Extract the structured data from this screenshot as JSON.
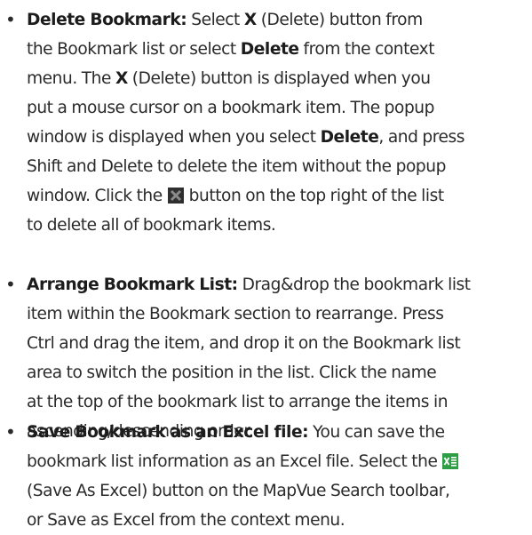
{
  "items": [
    {
      "lines": [
        [
          {
            "t": "Delete Bookmark:",
            "b": true
          },
          {
            "t": " Select "
          },
          {
            "t": "X",
            "b": true
          },
          {
            "t": " (Delete) button from"
          }
        ],
        [
          {
            "t": "the Bookmark list or select "
          },
          {
            "t": "Delete",
            "b": true
          },
          {
            "t": " from the context"
          }
        ],
        [
          {
            "t": "menu. The "
          },
          {
            "t": "X",
            "b": true
          },
          {
            "t": " (Delete) button is displayed when you"
          }
        ],
        [
          {
            "t": "put a mouse cursor on a bookmark item. The popup"
          }
        ],
        [
          {
            "t": "window is displayed when you select "
          },
          {
            "t": "Delete",
            "b": true
          },
          {
            "t": ", and press"
          }
        ],
        [
          {
            "t": "Shift and Delete to delete the item without the popup"
          }
        ],
        [
          {
            "t": "window. Click the "
          },
          {
            "icon": "delete-all-icon"
          },
          {
            "t": " button on the top right of the list"
          }
        ],
        [
          {
            "t": "to delete all of bookmark items."
          }
        ]
      ]
    },
    {
      "lines": [
        [
          {
            "t": "Arrange Bookmark List:",
            "b": true
          },
          {
            "t": " Drag&drop the bookmark list"
          }
        ],
        [
          {
            "t": "item within the Bookmark section to rearrange. Press"
          }
        ],
        [
          {
            "t": "Ctrl and drag the item, and drop it on the Bookmark list"
          }
        ],
        [
          {
            "t": "area to switch the position in the list. Click the name"
          }
        ],
        [
          {
            "t": "at the top of the bookmark list to arrange the items in"
          }
        ],
        [
          {
            "t": "ascending/descending order."
          }
        ]
      ]
    },
    {
      "lines": [
        [
          {
            "t": "Save Bookmark as an Excel file:",
            "b": true
          },
          {
            "t": " You can save the"
          }
        ],
        [
          {
            "t": "bookmark list information as an Excel file. Select the "
          },
          {
            "icon": "excel-icon"
          }
        ],
        [
          {
            "t": "(Save As Excel) button on the MapVue Search toolbar,"
          }
        ],
        [
          {
            "t": "or Save as Excel from the context menu."
          }
        ]
      ]
    }
  ],
  "colors": {
    "text": "#2a2a2a",
    "delete_icon_bg": "#2f2f2f",
    "delete_icon_x": "#8a8a8a",
    "excel_green": "#2e9e45"
  }
}
